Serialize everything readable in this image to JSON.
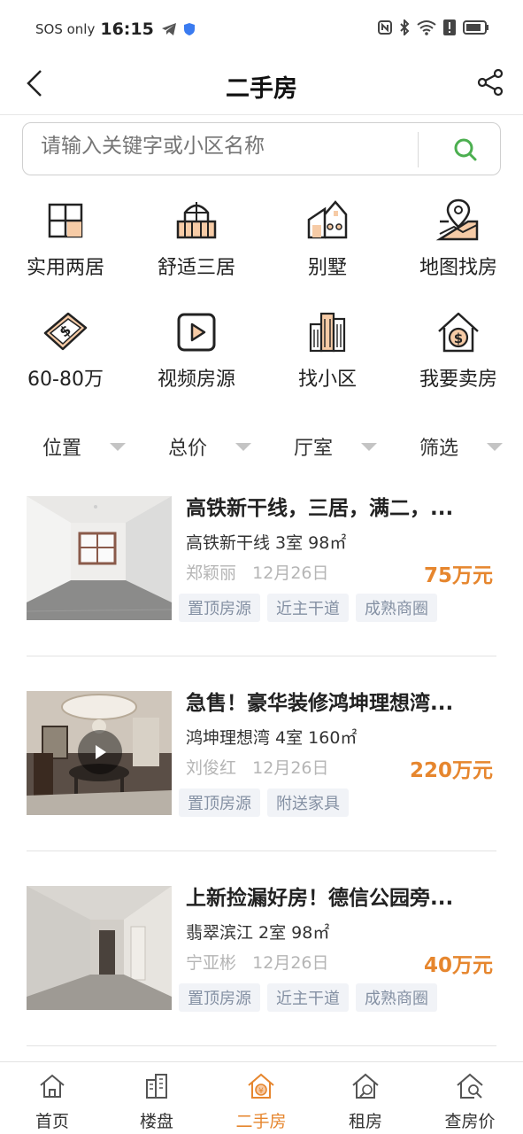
{
  "status": {
    "carrier": "SOS only",
    "time": "16:15"
  },
  "nav": {
    "title": "二手房"
  },
  "search": {
    "placeholder": "请输入关键字或小区名称"
  },
  "quick_entries": [
    {
      "label": "实用两居",
      "icon": "floorplan-icon"
    },
    {
      "label": "舒适三居",
      "icon": "balcony-icon"
    },
    {
      "label": "别墅",
      "icon": "villa-icon"
    },
    {
      "label": "地图找房",
      "icon": "map-pin-icon"
    },
    {
      "label": "60-80万",
      "icon": "money-icon"
    },
    {
      "label": "视频房源",
      "icon": "video-play-icon"
    },
    {
      "label": "找小区",
      "icon": "buildings-icon"
    },
    {
      "label": "我要卖房",
      "icon": "house-dollar-icon"
    }
  ],
  "filters": [
    {
      "label": "位置"
    },
    {
      "label": "总价"
    },
    {
      "label": "厅室"
    },
    {
      "label": "筛选"
    }
  ],
  "listings": [
    {
      "title": "高铁新干线，三居，满二，...",
      "subtitle": "高铁新干线 3室 98㎡",
      "agent": "郑颖丽",
      "date": "12月26日",
      "price": "75万元",
      "tags": [
        "置顶房源",
        "近主干道",
        "成熟商圈"
      ],
      "has_video": false
    },
    {
      "title": "急售！豪华装修鸿坤理想湾...",
      "subtitle": "鸿坤理想湾 4室 160㎡",
      "agent": "刘俊红",
      "date": "12月26日",
      "price": "220万元",
      "tags": [
        "置顶房源",
        "附送家具"
      ],
      "has_video": true
    },
    {
      "title": "上新捡漏好房！德信公园旁...",
      "subtitle": "翡翠滨江 2室 98㎡",
      "agent": "宁亚彬",
      "date": "12月26日",
      "price": "40万元",
      "tags": [
        "置顶房源",
        "近主干道",
        "成熟商圈"
      ],
      "has_video": false
    }
  ],
  "tabs": [
    {
      "label": "首页",
      "icon": "home-icon",
      "active": false
    },
    {
      "label": "楼盘",
      "icon": "building-icon",
      "active": false
    },
    {
      "label": "二手房",
      "icon": "house-yuan-icon",
      "active": true
    },
    {
      "label": "租房",
      "icon": "rent-house-icon",
      "active": false
    },
    {
      "label": "查房价",
      "icon": "house-search-icon",
      "active": false
    }
  ],
  "colors": {
    "accent": "#e6862e",
    "search_icon": "#4caf50",
    "tag_bg": "#f1f3f7",
    "tag_text": "#8490a3"
  }
}
